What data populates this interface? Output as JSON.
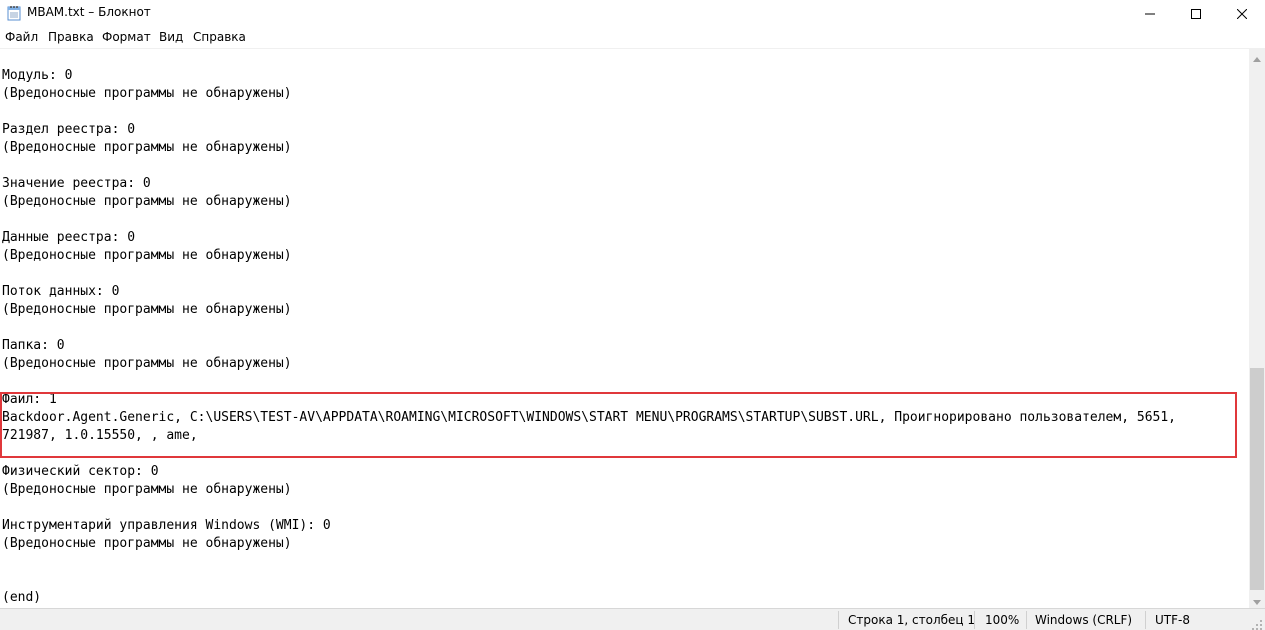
{
  "window": {
    "title": "MBAM.txt – Блокнот"
  },
  "menu": {
    "items": [
      "Файл",
      "Правка",
      "Формат",
      "Вид",
      "Справка"
    ]
  },
  "editor": {
    "lines": [
      "Модуль: 0",
      "(Вредоносные программы не обнаружены)",
      "",
      "Раздел реестра: 0",
      "(Вредоносные программы не обнаружены)",
      "",
      "Значение реестра: 0",
      "(Вредоносные программы не обнаружены)",
      "",
      "Данные реестра: 0",
      "(Вредоносные программы не обнаружены)",
      "",
      "Поток данных: 0",
      "(Вредоносные программы не обнаружены)",
      "",
      "Папка: 0",
      "(Вредоносные программы не обнаружены)",
      "",
      "Файл: 1",
      "Backdoor.Agent.Generic, C:\\USERS\\TEST-AV\\APPDATA\\ROAMING\\MICROSOFT\\WINDOWS\\START MENU\\PROGRAMS\\STARTUP\\SUBST.URL, Проигнорировано пользователем, 5651,",
      "721987, 1.0.15550, , ame,",
      "",
      "Физический сектор: 0",
      "(Вредоносные программы не обнаружены)",
      "",
      "Инструментарий управления Windows (WMI): 0",
      "(Вредоносные программы не обнаружены)",
      "",
      "",
      "(end)"
    ]
  },
  "statusbar": {
    "position": "Строка 1, столбец 1",
    "zoom": "100%",
    "line_ending": "Windows (CRLF)",
    "encoding": "UTF-8"
  },
  "icons": {
    "app": "notepad-icon",
    "minimize": "minimize-icon",
    "maximize": "maximize-icon",
    "close": "close-icon"
  },
  "colors": {
    "highlight_border": "#e0383b",
    "statusbar_bg": "#f0f0f0"
  }
}
